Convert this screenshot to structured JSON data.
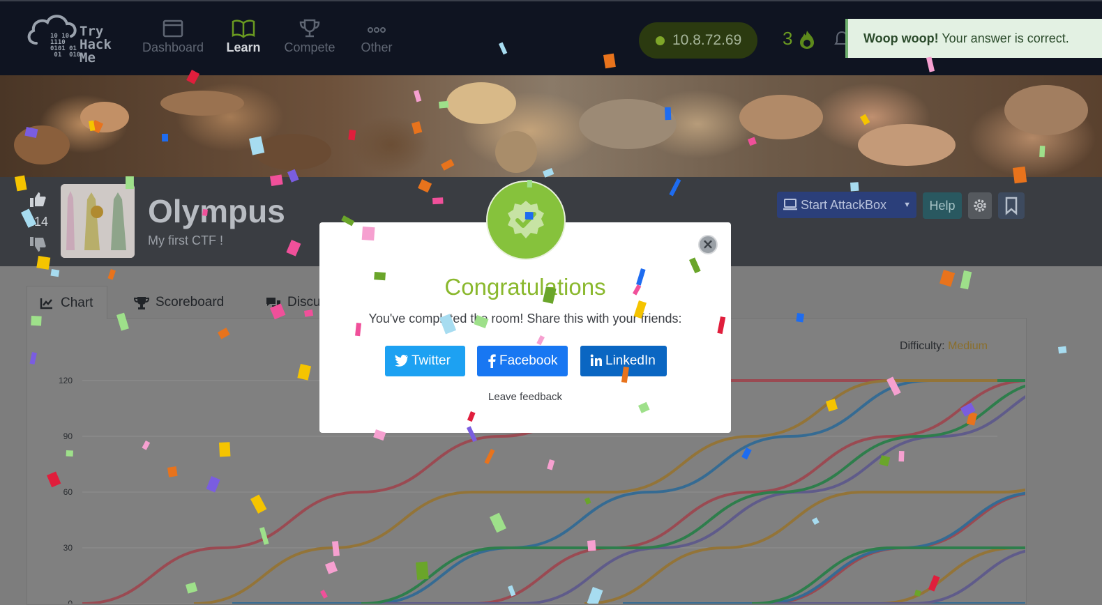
{
  "navbar": {
    "logo_text": "Try\nHack\nMe",
    "logo_binary": "10 10\n1110\n0101 01\n 01  010",
    "items": [
      {
        "label": "Dashboard",
        "icon": "browser-window-icon",
        "active": false
      },
      {
        "label": "Learn",
        "icon": "open-book-icon",
        "active": true
      },
      {
        "label": "Compete",
        "icon": "trophy-icon",
        "active": false
      },
      {
        "label": "Other",
        "icon": "ellipsis-icon",
        "active": false
      }
    ],
    "vpn_ip": "10.8.72.69",
    "streak_count": "3",
    "streak_icon": "flame-icon"
  },
  "toast": {
    "bold": "Woop woop!",
    "text": " Your answer is correct."
  },
  "room": {
    "votes": "214",
    "title": "Olympus",
    "subtitle": "My first CTF !",
    "buttons": {
      "attackbox": "Start AttackBox",
      "help": "Help"
    }
  },
  "tabs": [
    {
      "label": "Chart",
      "icon": "line-chart-icon"
    },
    {
      "label": "Scoreboard",
      "icon": "trophy-icon"
    },
    {
      "label": "Discu",
      "icon": "comments-icon"
    }
  ],
  "difficulty": {
    "label": "Difficulty: ",
    "value": "Medium"
  },
  "modal": {
    "title": "Congratulations",
    "message": "You've completed the room! Share this with your friends:",
    "share_buttons": {
      "twitter": "Twitter",
      "facebook": "Facebook",
      "linkedin": "LinkedIn"
    },
    "feedback": "Leave feedback"
  },
  "colors": {
    "accent_green": "#86c23c",
    "twitter": "#1da1f2",
    "facebook": "#1877f2",
    "linkedin": "#0a66c2",
    "navbar": "#0f1421"
  },
  "chart_data": {
    "type": "line",
    "title": "",
    "xlabel": "",
    "ylabel": "",
    "ylim": [
      0,
      120
    ],
    "yticks": [
      "120",
      "90",
      "60",
      "30",
      "0"
    ],
    "series": [
      {
        "color": "#9a4a52",
        "x": [
          0,
          4,
          8,
          12,
          16,
          20,
          24
        ],
        "values": [
          0,
          30,
          60,
          90,
          120,
          120,
          120
        ]
      },
      {
        "color": "#356b93",
        "x": [
          0,
          4,
          8,
          12,
          16,
          20,
          24
        ],
        "values": [
          0,
          0,
          30,
          60,
          90,
          120,
          120
        ]
      },
      {
        "color": "#937438",
        "x": [
          0,
          4,
          8,
          12,
          16,
          20,
          24
        ],
        "values": [
          0,
          30,
          60,
          60,
          90,
          120,
          120
        ]
      },
      {
        "color": "#5f5b8a",
        "x": [
          0,
          4,
          8,
          12,
          16,
          20,
          24
        ],
        "values": [
          0,
          0,
          30,
          60,
          90,
          120,
          120
        ]
      },
      {
        "color": "#2e7e4c",
        "x": [
          0,
          4,
          8,
          12,
          16,
          20,
          24
        ],
        "values": [
          0,
          30,
          30,
          60,
          90,
          120,
          120
        ]
      }
    ]
  }
}
